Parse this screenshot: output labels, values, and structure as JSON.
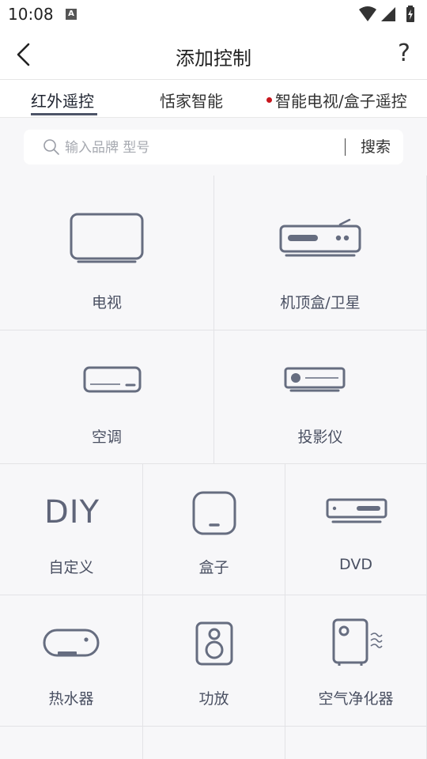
{
  "status_bar": {
    "time": "10:08",
    "notification_badge": "A",
    "icons": [
      "wifi-icon",
      "signal-icon",
      "battery-charging-icon"
    ]
  },
  "header": {
    "title": "添加控制",
    "back_icon": "chevron-left-icon",
    "help_label": "?"
  },
  "tabs": [
    {
      "label": "红外遥控",
      "active": true
    },
    {
      "label": "恬家智能",
      "active": false
    },
    {
      "label": "智能电视/盒子遥控",
      "active": false,
      "dot_color": "#c8161d"
    }
  ],
  "search": {
    "placeholder": "输入品牌 型号",
    "value": "",
    "button_label": "搜索"
  },
  "devices": {
    "tv": {
      "label": "电视",
      "icon": "tv-icon"
    },
    "stb": {
      "label": "机顶盒/卫星",
      "icon": "set-top-box-icon"
    },
    "ac": {
      "label": "空调",
      "icon": "air-conditioner-icon"
    },
    "projector": {
      "label": "投影仪",
      "icon": "projector-icon"
    },
    "diy": {
      "label": "自定义",
      "icon_text": "DIY"
    },
    "box": {
      "label": "盒子",
      "icon": "media-box-icon"
    },
    "dvd": {
      "label": "DVD",
      "icon": "dvd-player-icon"
    },
    "heater": {
      "label": "热水器",
      "icon": "water-heater-icon"
    },
    "amp": {
      "label": "功放",
      "icon": "speaker-icon"
    },
    "purifier": {
      "label": "空气净化器",
      "icon": "air-purifier-icon"
    }
  },
  "colors": {
    "icon_stroke": "#666d80",
    "active_tab_underline": "#4d5468",
    "background": "#f7f7f9"
  }
}
